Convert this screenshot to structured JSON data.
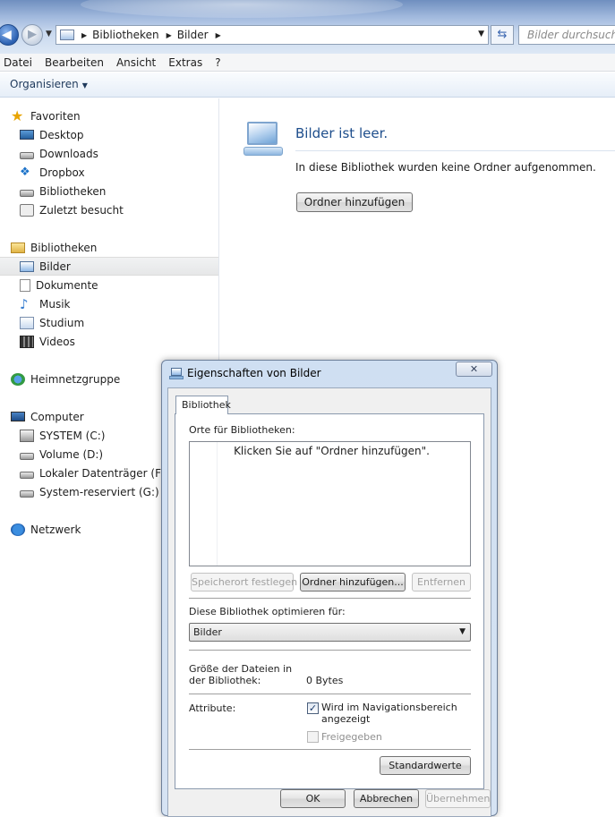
{
  "window": {
    "address": {
      "crumbs": [
        "Bibliotheken",
        "Bilder"
      ]
    },
    "search_placeholder": "Bilder durchsuchen",
    "menu": [
      "Datei",
      "Bearbeiten",
      "Ansicht",
      "Extras",
      "?"
    ],
    "organize_label": "Organisieren"
  },
  "nav": {
    "favorites": {
      "label": "Favoriten",
      "items": [
        "Desktop",
        "Downloads",
        "Dropbox",
        "Bibliotheken",
        "Zuletzt besucht"
      ]
    },
    "libraries": {
      "label": "Bibliotheken",
      "items": [
        "Bilder",
        "Dokumente",
        "Musik",
        "Studium",
        "Videos"
      ],
      "selected": "Bilder"
    },
    "homegroup": "Heimnetzgruppe",
    "computer": {
      "label": "Computer",
      "items": [
        "SYSTEM (C:)",
        "Volume (D:)",
        "Lokaler Datenträger (F:)",
        "System-reserviert (G:)"
      ]
    },
    "network": "Netzwerk"
  },
  "content": {
    "title": "Bilder ist leer.",
    "message": "In diese Bibliothek wurden keine Ordner aufgenommen.",
    "add_folder_button": "Ordner hinzufügen"
  },
  "dialog": {
    "title": "Eigenschaften von Bilder",
    "close_glyph": "✕",
    "tab": "Bibliothek",
    "locations_label": "Orte für Bibliotheken:",
    "locations_hint": "Klicken Sie auf \"Ordner hinzufügen\".",
    "buttons": {
      "set_save_location": "Speicherort festlegen",
      "add_folder": "Ordner hinzufügen...",
      "remove": "Entfernen",
      "restore_defaults": "Standardwerte",
      "ok": "OK",
      "cancel": "Abbrechen",
      "apply": "Übernehmen"
    },
    "optimize_label": "Diese Bibliothek optimieren für:",
    "optimize_value": "Bilder",
    "size_label": "Größe der Dateien in der Bibliothek:",
    "size_value": "0 Bytes",
    "attributes_label": "Attribute:",
    "attr_nav_label": "Wird im Navigationsbereich angezeigt",
    "attr_nav_checked": true,
    "attr_shared_label": "Freigegeben",
    "attr_shared_checked": false
  },
  "colors": {
    "accent": "#1e4e8c",
    "titlebar": "#9fb7dc",
    "selection": "#e6e7e8"
  }
}
